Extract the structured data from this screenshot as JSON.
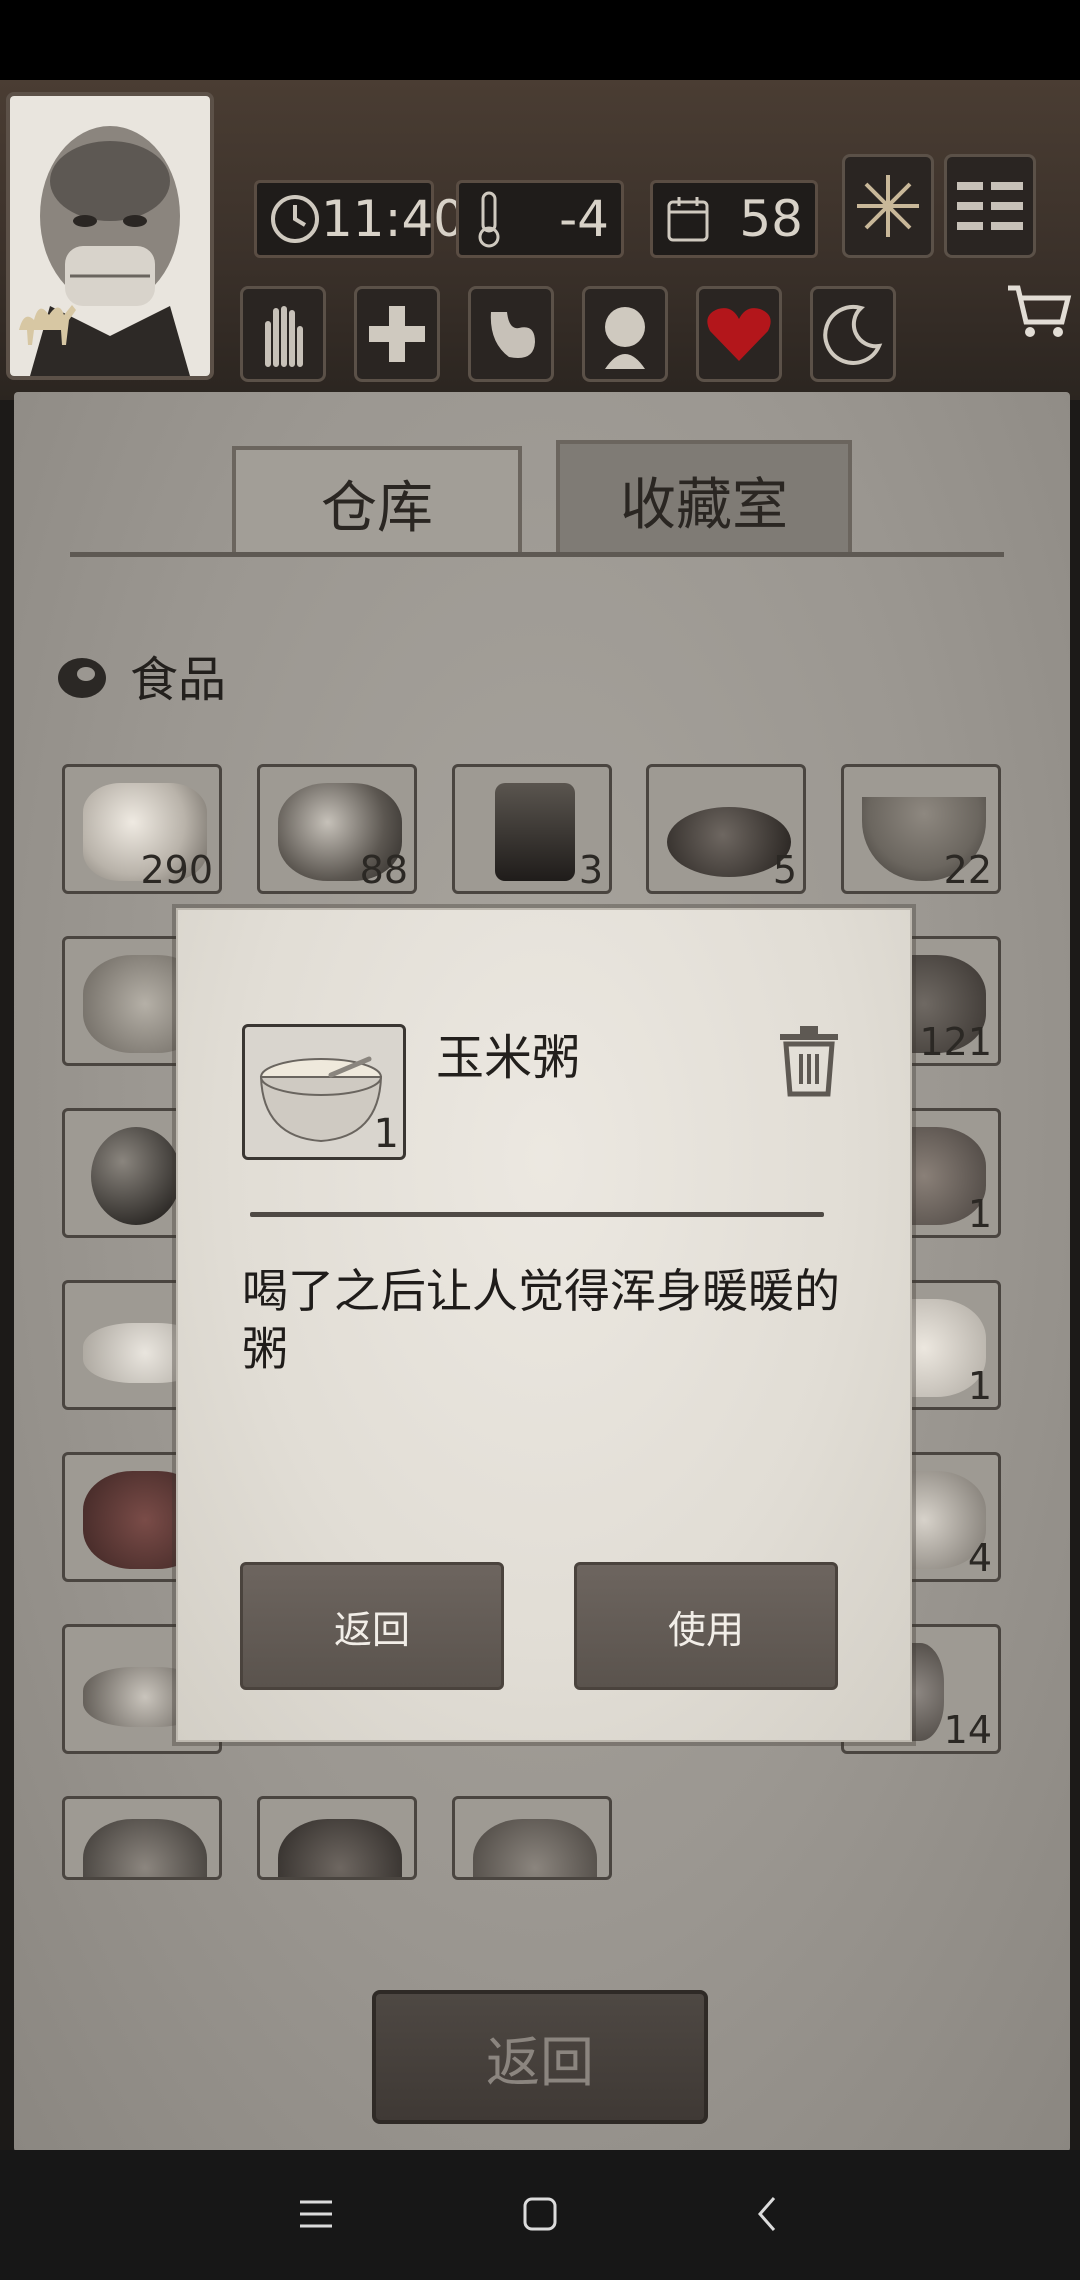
{
  "hud": {
    "time": "11:40",
    "temperature": "-4",
    "days": "58"
  },
  "tabs": [
    {
      "label": "仓库"
    },
    {
      "label": "收藏室"
    }
  ],
  "category": {
    "label": "食品"
  },
  "items_row1": [
    {
      "name": "meat-item",
      "count": "290"
    },
    {
      "name": "coconut-item",
      "count": "88"
    },
    {
      "name": "cup-item",
      "count": "3"
    },
    {
      "name": "steak-item",
      "count": "5"
    },
    {
      "name": "soup-bowl-item",
      "count": "22"
    }
  ],
  "items_right": [
    {
      "count": "121"
    },
    {
      "count": "1"
    },
    {
      "count": "1"
    },
    {
      "count": "4"
    },
    {
      "count": "14"
    }
  ],
  "modal": {
    "item_name": "玉米粥",
    "item_count": "1",
    "description": "喝了之后让人觉得浑身暖暖的粥",
    "back_label": "返回",
    "use_label": "使用"
  },
  "bottom_back_label": "返回",
  "colors": {
    "paper": "#e6e2db",
    "panel": "#9b9791",
    "wood_button": "#625b55",
    "heart_red": "#b3161b"
  }
}
